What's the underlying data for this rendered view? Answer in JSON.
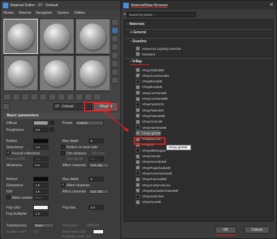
{
  "material_editor": {
    "title": "Material Editor - 07 - Default",
    "menu": [
      "Modes",
      "Material",
      "Navigation",
      "Options",
      "Utilities"
    ],
    "material_name": "07 - Default",
    "material_type": "VRayMtl",
    "rollout_title": "Basic parameters",
    "diffuse": {
      "label": "Diffuse",
      "preset_label": "Preset",
      "preset_value": "Custom"
    },
    "roughness": {
      "label": "Roughness",
      "value": "0.0"
    },
    "reflect": {
      "label": "Reflect",
      "max_depth_label": "Max depth",
      "max_depth": "8"
    },
    "glossiness": {
      "label": "Glossiness",
      "value": "1.0",
      "back_side": "Reflect on back side"
    },
    "fresnel": "Fresnel reflections",
    "fresnel_ior": {
      "label": "Fresnel IOR",
      "value": "1.6"
    },
    "dim_distance": {
      "label": "Dim distance",
      "value": "100.0cm"
    },
    "dim_falloff": {
      "label": "Dim fall off",
      "value": "0.0"
    },
    "metalness": {
      "label": "Metalness",
      "value": "0.0"
    },
    "affect_channels": {
      "label": "Affect channels",
      "value": "Col...nly"
    },
    "refract": {
      "label": "Refract",
      "max_depth_label": "Max depth",
      "max_depth": "8"
    },
    "refr_glossiness": {
      "label": "Glossiness",
      "value": "1.0",
      "affect_shadows": "Affect shadows"
    },
    "ior": {
      "label": "IOR",
      "value": "1.6",
      "affect_label": "Affect channels",
      "affect_value": "Col...nly"
    },
    "abbe": "Abbe number",
    "abbe_value": "50.0",
    "fog_color": {
      "label": "Fog color",
      "bias_label": "Fog bias",
      "bias_value": "0.0"
    },
    "fog_multiplier": {
      "label": "Fog multiplier",
      "value": "1.0"
    },
    "translucency": {
      "label": "Translucency",
      "value": "None",
      "thickness_label": "Thickness",
      "thickness_value": "1000.0m"
    },
    "scatter": {
      "label": "Scatter coeff",
      "value": "0.0",
      "fwd_label": "Fwd/bck coeff",
      "fwd_value": "1.0"
    },
    "back_side": "Back-side color"
  },
  "browser": {
    "title": "Material/Map Browser",
    "search_placeholder": "Search by Name ...",
    "root": "Materials",
    "groups": {
      "general": "General",
      "scanline": "Scanline",
      "vray": "V-Ray"
    },
    "scanline_items": [
      "Advanced Lighting Override",
      "Standard"
    ],
    "vray_items": [
      "VRay2SidedMtl",
      "VRayALSurfaceMtl",
      "VRayBlendMtl",
      "VRayBumpMtl",
      "VRayCarPaintMtl",
      "VRayCarPaintMtl2",
      "VRayFastSSS2",
      "VRayFlakesMtl",
      "VRayFlakesMtl2",
      "VRayGLSLMtl",
      "VRayHairNextMtl",
      "VRayLightMtl",
      "VRayMDLMtl",
      "VRayMtl",
      "VRayMtlWrapper",
      "VRayOSLMtl",
      "VRayOverrideMtl",
      "VRayPluginNodeMtl",
      "VRayPointParticleMtl",
      "VRayScannedMtl",
      "VRayScatterVolume",
      "VRayStochasticFlakesMtl",
      "VRaySwitchMtl",
      "VRayToonMtl"
    ],
    "selected_index": 11,
    "tooltip": "VRayLightMtl",
    "ok": "OK",
    "cancel": "Cancel"
  },
  "colors": {
    "highlight": "#e02020",
    "selection": "#5a5a5a",
    "accent": "#3d6fa8"
  }
}
